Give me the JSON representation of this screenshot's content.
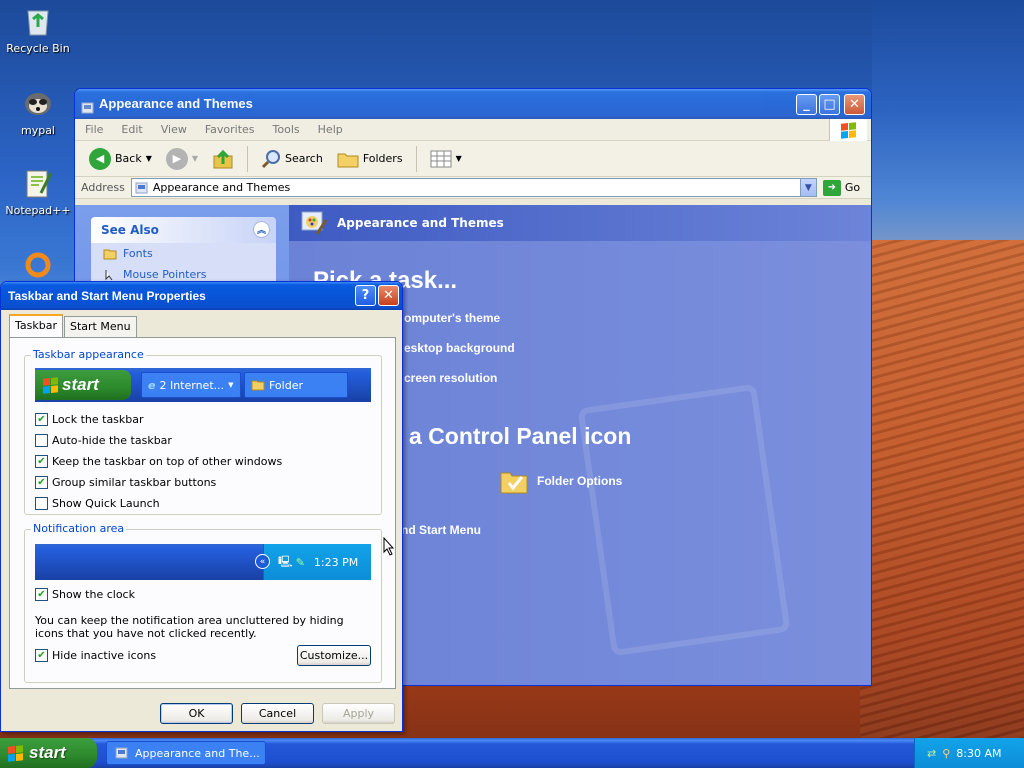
{
  "desktop": {
    "icons": [
      {
        "label": "Recycle Bin"
      },
      {
        "label": "mypal"
      },
      {
        "label": "Notepad++"
      }
    ]
  },
  "explorer": {
    "title": "Appearance and Themes",
    "menu": [
      "File",
      "Edit",
      "View",
      "Favorites",
      "Tools",
      "Help"
    ],
    "toolbar": {
      "back": "Back",
      "search": "Search",
      "folders": "Folders"
    },
    "address": {
      "label": "Address",
      "value": "Appearance and Themes",
      "go": "Go"
    },
    "see_also": {
      "title": "See Also",
      "items": [
        "Fonts",
        "Mouse Pointers"
      ]
    },
    "pane": {
      "header": "Appearance and Themes",
      "pick_task": "Pick a task...",
      "tasks": [
        "omputer's theme",
        "esktop background",
        "creen resolution"
      ],
      "pick_icon": "a Control Panel icon",
      "folder_options": "Folder Options",
      "start_menu": "nd Start Menu"
    }
  },
  "dialog": {
    "title": "Taskbar and Start Menu Properties",
    "tabs": [
      "Taskbar",
      "Start Menu"
    ],
    "appearance": {
      "label": "Taskbar appearance",
      "preview": {
        "start": "start",
        "ie_btn": "2 Internet...",
        "folder_btn": "Folder"
      },
      "options": [
        {
          "label": "Lock the taskbar",
          "checked": true
        },
        {
          "label": "Auto-hide the taskbar",
          "checked": false
        },
        {
          "label": "Keep the taskbar on top of other windows",
          "checked": true
        },
        {
          "label": "Group similar taskbar buttons",
          "checked": true
        },
        {
          "label": "Show Quick Launch",
          "checked": false
        }
      ]
    },
    "notification": {
      "label": "Notification area",
      "preview_time": "1:23 PM",
      "show_clock": {
        "label": "Show the clock",
        "checked": true
      },
      "description": "You can keep the notification area uncluttered by hiding icons that you have not clicked recently.",
      "hide_inactive": {
        "label": "Hide inactive icons",
        "checked": true
      },
      "customize": "Customize..."
    },
    "buttons": {
      "ok": "OK",
      "cancel": "Cancel",
      "apply": "Apply"
    }
  },
  "taskbar": {
    "start": "start",
    "task": "Appearance and The...",
    "clock": "8:30 AM"
  }
}
